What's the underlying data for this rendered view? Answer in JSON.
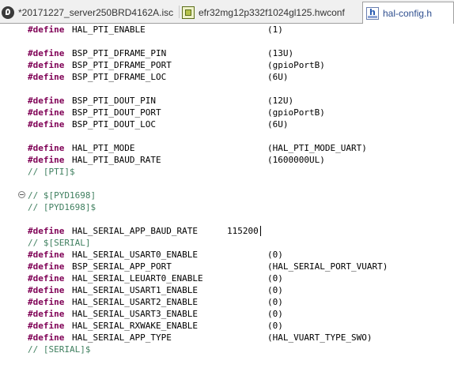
{
  "tabs": [
    {
      "label": "*20171227_server250BRD4162A.isc",
      "icon": "simplicity-isc-icon",
      "active": false
    },
    {
      "label": "efr32mg12p332f1024gl125.hwconf",
      "icon": "hwconf-chip-icon",
      "active": false
    },
    {
      "label": "hal-config.h",
      "icon": "c-header-file-icon",
      "active": true
    }
  ],
  "editor": {
    "lines": [
      {
        "kw": "#define",
        "name": "HAL_PTI_ENABLE",
        "value": "(1)"
      },
      {
        "kw": "#define",
        "name": "BSP_PTI_DFRAME_PIN",
        "value": "(13U)"
      },
      {
        "kw": "#define",
        "name": "BSP_PTI_DFRAME_PORT",
        "value": "(gpioPortB)"
      },
      {
        "kw": "#define",
        "name": "BSP_PTI_DFRAME_LOC",
        "value": "(6U)"
      },
      {
        "kw": "#define",
        "name": "BSP_PTI_DOUT_PIN",
        "value": "(12U)"
      },
      {
        "kw": "#define",
        "name": "BSP_PTI_DOUT_PORT",
        "value": "(gpioPortB)"
      },
      {
        "kw": "#define",
        "name": "BSP_PTI_DOUT_LOC",
        "value": "(6U)"
      },
      {
        "kw": "#define",
        "name": "HAL_PTI_MODE",
        "value": "(HAL_PTI_MODE_UART)"
      },
      {
        "kw": "#define",
        "name": "HAL_PTI_BAUD_RATE",
        "value": "(1600000UL)"
      },
      {
        "comment": "// [PTI]$"
      },
      {
        "comment": "// $[PYD1698]"
      },
      {
        "comment": "// [PYD1698]$"
      },
      {
        "kw": "#define",
        "name": "HAL_SERIAL_APP_BAUD_RATE",
        "value": "115200"
      },
      {
        "comment": "// $[SERIAL]"
      },
      {
        "kw": "#define",
        "name": "HAL_SERIAL_USART0_ENABLE",
        "value": "(0)"
      },
      {
        "kw": "#define",
        "name": "BSP_SERIAL_APP_PORT",
        "value": "(HAL_SERIAL_PORT_VUART)"
      },
      {
        "kw": "#define",
        "name": "HAL_SERIAL_LEUART0_ENABLE",
        "value": "(0)"
      },
      {
        "kw": "#define",
        "name": "HAL_SERIAL_USART1_ENABLE",
        "value": "(0)"
      },
      {
        "kw": "#define",
        "name": "HAL_SERIAL_USART2_ENABLE",
        "value": "(0)"
      },
      {
        "kw": "#define",
        "name": "HAL_SERIAL_USART3_ENABLE",
        "value": "(0)"
      },
      {
        "kw": "#define",
        "name": "HAL_SERIAL_RXWAKE_ENABLE",
        "value": "(0)"
      },
      {
        "kw": "#define",
        "name": "HAL_SERIAL_APP_TYPE",
        "value": "(HAL_VUART_TYPE_SWO)"
      },
      {
        "comment": "// [SERIAL]$"
      }
    ]
  },
  "colors": {
    "keyword": "#7f0055",
    "comment": "#3f7f5f",
    "text": "#000000"
  }
}
